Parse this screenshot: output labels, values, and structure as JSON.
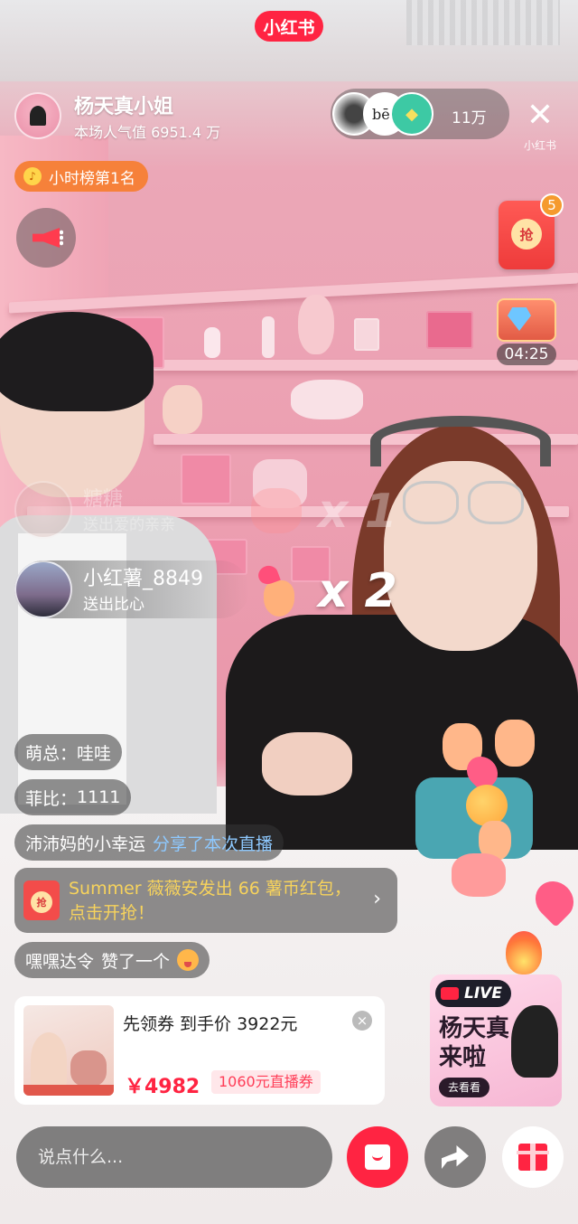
{
  "app": {
    "logo_text": "小红书",
    "watermark": "小红书"
  },
  "host": {
    "name": "杨天真小姐",
    "popularity": "本场人气值 6951.4 万"
  },
  "viewers": {
    "count": "11万",
    "avatar2_text": "bēs"
  },
  "rank_badge": {
    "label": "小时榜第1名"
  },
  "red_packet": {
    "label": "抢",
    "badge_count": "5"
  },
  "treasure_box": {
    "timer": "04:25"
  },
  "gifts": [
    {
      "user": "糖糖",
      "action": "送出爱的亲亲",
      "multiplier": "x 1"
    },
    {
      "user": "小红薯_8849",
      "action": "送出比心",
      "multiplier": "x 2"
    }
  ],
  "chat_messages": [
    {
      "user": "萌总：",
      "text": "哇哇"
    },
    {
      "user": "菲比：",
      "text": "1111"
    },
    {
      "user": "沛沛妈的小幸运",
      "text": "分享了本次直播"
    },
    {
      "system_text": "Summer 薇薇安发出 66 薯币红包，点击开抢！",
      "icon_label": "抢"
    },
    {
      "user": "嘿嘿达令",
      "text": "赞了一个"
    }
  ],
  "product": {
    "title": "先领券 到手价 3922元",
    "price": "￥4982",
    "coupon": "1060元直播券"
  },
  "live_promo": {
    "badge": "LIVE",
    "title": "杨天真来啦",
    "button": "去看看"
  },
  "bottom_bar": {
    "input_placeholder": "说点什么..."
  },
  "colors": {
    "brand_red": "#ff2442",
    "rank_orange": "#f6813a",
    "highlight_blue": "#8ec9ff",
    "packet_yellow": "#f7d35c"
  }
}
